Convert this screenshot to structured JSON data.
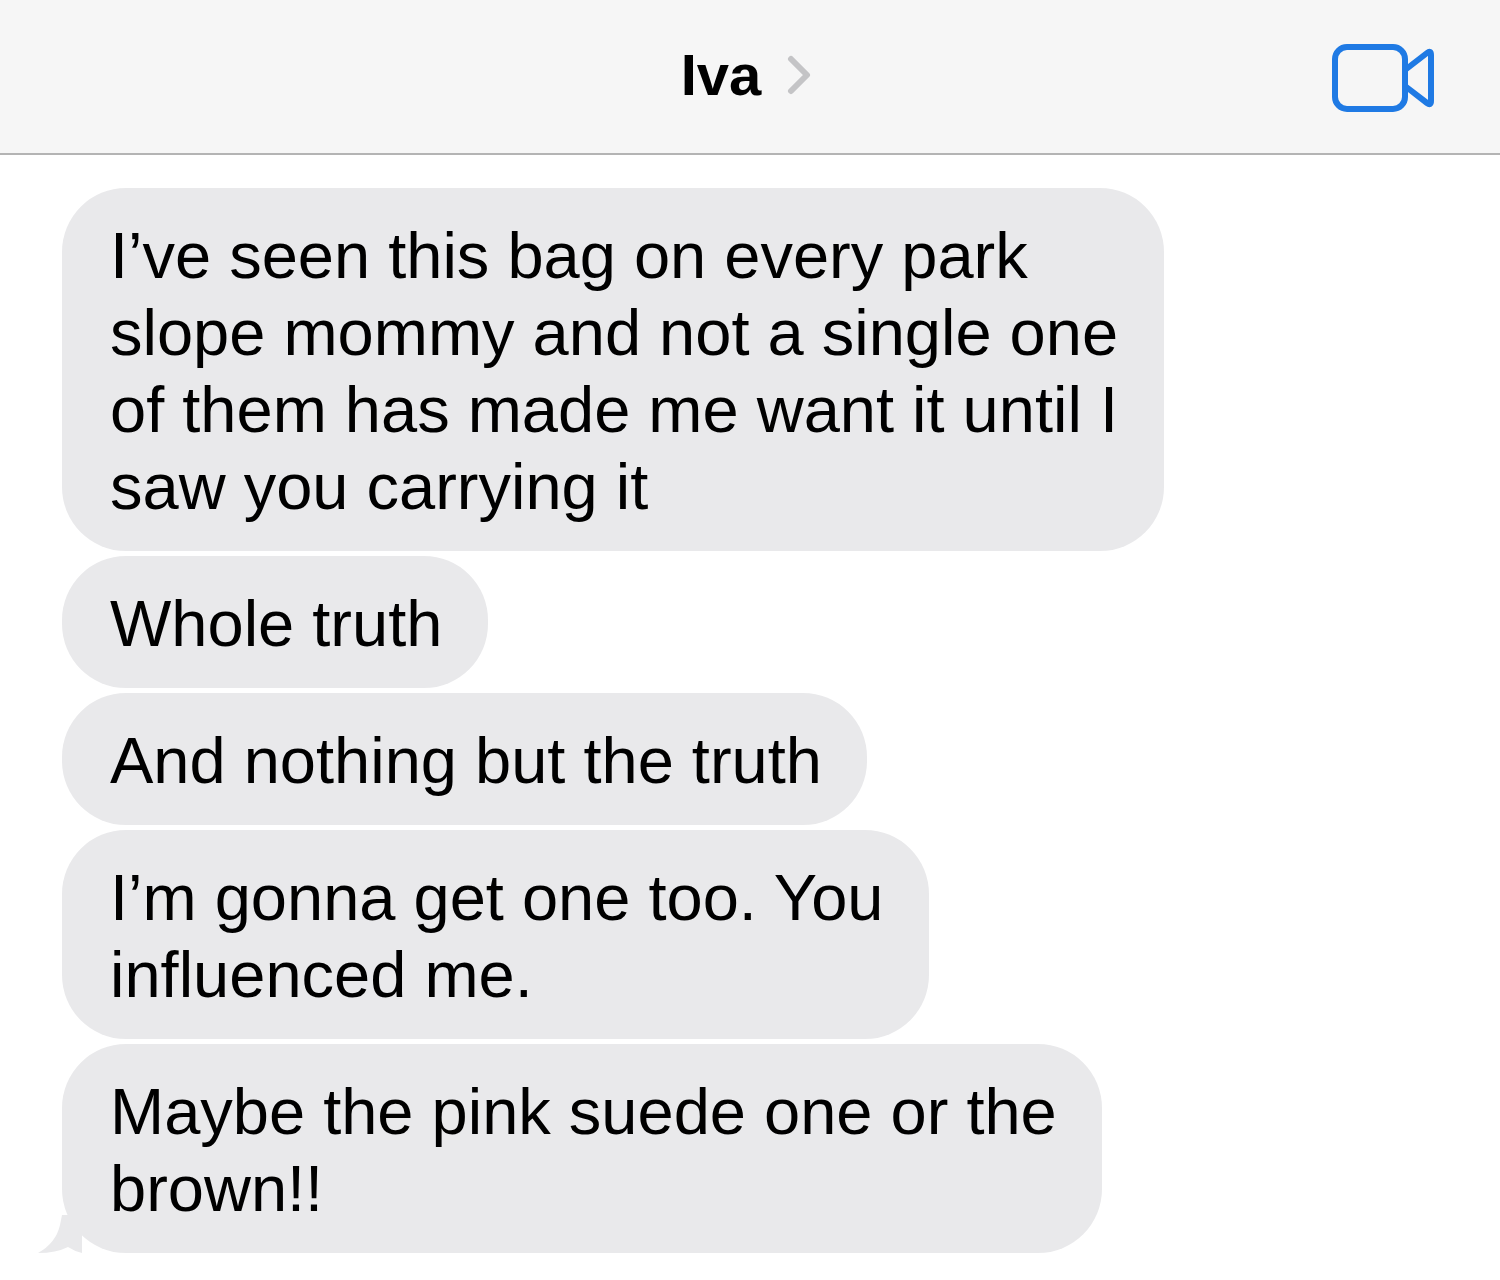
{
  "header": {
    "contact_name": "Iva"
  },
  "messages": [
    {
      "text": "I’ve seen this bag on every park slope mommy and not a single one of them has made me want it until I saw you carrying it",
      "tail": false
    },
    {
      "text": "Whole truth",
      "tail": false
    },
    {
      "text": "And nothing but the truth",
      "tail": false
    },
    {
      "text": "I’m gonna get one too. You influenced me.",
      "tail": false
    },
    {
      "text": "Maybe the pink suede one or the brown!!",
      "tail": true
    }
  ]
}
